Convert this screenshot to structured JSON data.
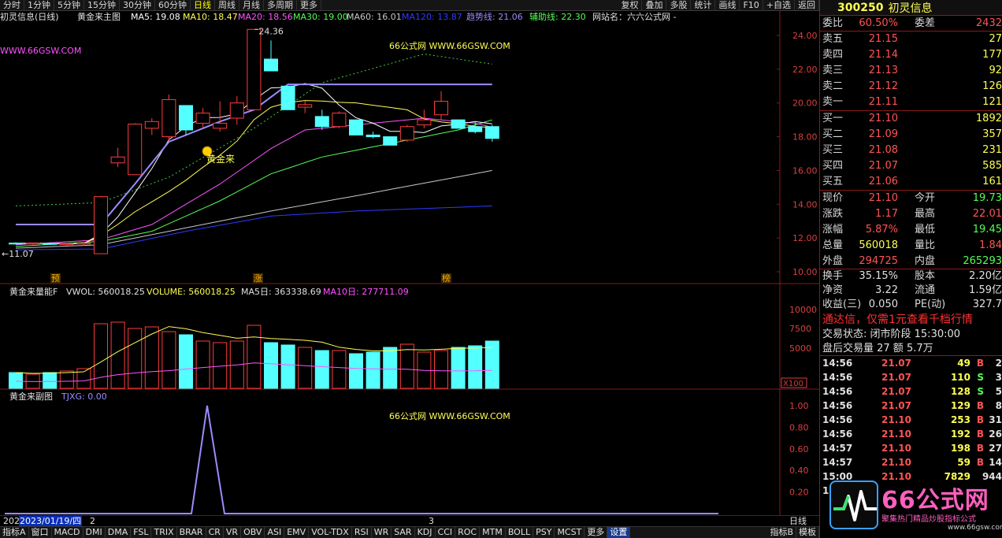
{
  "toolbar": {
    "left_tabs": [
      "分时",
      "1分钟",
      "5分钟",
      "15分钟",
      "30分钟",
      "60分钟",
      "日线",
      "周线",
      "月线",
      "多周期",
      "更多"
    ],
    "active_tab": "日线",
    "right_tabs": [
      "复权",
      "叠加",
      "多股",
      "统计",
      "画线",
      "F10",
      "+自选",
      "返回"
    ]
  },
  "main_pane": {
    "title": "初灵信息(日线)",
    "indicator": "黄金来主图",
    "readouts": [
      {
        "label": "MA5: 19.08",
        "color": "#ffffff"
      },
      {
        "label": "MA10: 18.47",
        "color": "#ffff54"
      },
      {
        "label": "MA20: 18.56",
        "color": "#ff54ff"
      },
      {
        "label": "MA30: 19.00",
        "color": "#54ff54"
      },
      {
        "label": "MA60: 16.01",
        "color": "#c8c8c8"
      },
      {
        "label": "MA120: 13.87",
        "color": "#2f3bff"
      },
      {
        "label": "趋势线: 21.06",
        "color": "#9a8cff"
      },
      {
        "label": "辅助线: 22.30",
        "color": "#54ff54"
      },
      {
        "label": "网站名：六六公式网 -",
        "color": "#e0e0e0"
      }
    ],
    "url_label": "WWW.66GSW.COM",
    "watermark": "66公式网 WWW.66GSW.COM",
    "y_ticks": [
      "24.00",
      "22.00",
      "20.00",
      "18.00",
      "16.00",
      "14.00",
      "12.00",
      "10.00"
    ],
    "high_label": "24.36",
    "low_label": "←11.07",
    "signal_label": "黄金来",
    "bottom_tags": [
      "预",
      "涨",
      "榜"
    ]
  },
  "volume_pane": {
    "indicator": "黄金来量能F",
    "readouts": [
      {
        "label": "VWOL: 560018.25",
        "color": "#e0e0e0"
      },
      {
        "label": "VOLUME: 560018.25",
        "color": "#ffff54"
      },
      {
        "label": "MA5日: 363338.69",
        "color": "#e0e0e0"
      },
      {
        "label": "MA10日: 277711.09",
        "color": "#ff54ff"
      }
    ],
    "y_ticks": [
      "10000",
      "7500",
      "5000"
    ],
    "unit": "X100"
  },
  "sub_pane": {
    "indicator": "黄金来副图",
    "readout": "TJXG: 0.00",
    "watermark": "66公式网 WWW.66GSW.COM",
    "y_ticks": [
      "1.00",
      "0.80",
      "0.60",
      "0.40",
      "0.20"
    ]
  },
  "date_strip": {
    "left": "202",
    "cursor_date": "2023/01/19/四",
    "mark_a": "2",
    "mark_b": "3",
    "period": "日线"
  },
  "bottom_tabs": [
    "指标A",
    "窗口",
    "MACD",
    "DMI",
    "DMA",
    "FSL",
    "TRIX",
    "BRAR",
    "CR",
    "VR",
    "OBV",
    "ASI",
    "EMV",
    "VOL-TDX",
    "RSI",
    "WR",
    "SAR",
    "KDJ",
    "CCI",
    "ROC",
    "MTM",
    "BOLL",
    "PSY",
    "MCST",
    "更多",
    "设置"
  ],
  "bottom_tabs_active": "设置",
  "bottom_tabs_right": [
    "指标B",
    "模板"
  ],
  "quote": {
    "code": "300250",
    "name": "初灵信息",
    "weibi_label": "委比",
    "weibi": "60.50%",
    "weicha_label": "委差",
    "weicha": "2432",
    "asks": [
      {
        "label": "卖五",
        "price": "21.15",
        "vol": "27"
      },
      {
        "label": "卖四",
        "price": "21.14",
        "vol": "177"
      },
      {
        "label": "卖三",
        "price": "21.13",
        "vol": "92"
      },
      {
        "label": "卖二",
        "price": "21.12",
        "vol": "126"
      },
      {
        "label": "卖一",
        "price": "21.11",
        "vol": "121"
      }
    ],
    "bids": [
      {
        "label": "买一",
        "price": "21.10",
        "vol": "1892"
      },
      {
        "label": "买二",
        "price": "21.09",
        "vol": "357"
      },
      {
        "label": "买三",
        "price": "21.08",
        "vol": "231"
      },
      {
        "label": "买四",
        "price": "21.07",
        "vol": "585"
      },
      {
        "label": "买五",
        "price": "21.06",
        "vol": "161"
      }
    ],
    "stats": [
      {
        "l1": "现价",
        "v1": "21.10",
        "c1": "red",
        "l2": "今开",
        "v2": "19.73",
        "c2": "green"
      },
      {
        "l1": "涨跌",
        "v1": "1.17",
        "c1": "red",
        "l2": "最高",
        "v2": "22.01",
        "c2": "red"
      },
      {
        "l1": "涨幅",
        "v1": "5.87%",
        "c1": "red",
        "l2": "最低",
        "v2": "19.45",
        "c2": "green"
      },
      {
        "l1": "总量",
        "v1": "560018",
        "c1": "yellow",
        "l2": "量比",
        "v2": "1.84",
        "c2": "red"
      },
      {
        "l1": "外盘",
        "v1": "294725",
        "c1": "red",
        "l2": "内盘",
        "v2": "265293",
        "c2": "green"
      },
      {
        "l1": "换手",
        "v1": "35.15%",
        "c1": "white",
        "l2": "股本",
        "v2": "2.20亿",
        "c2": "white"
      },
      {
        "l1": "净资",
        "v1": "3.22",
        "c1": "white",
        "l2": "流通",
        "v2": "1.59亿",
        "c2": "white"
      },
      {
        "l1": "收益(三)",
        "v1": "0.050",
        "c1": "white",
        "l2": "PE(动)",
        "v2": "327.7",
        "c2": "white"
      }
    ],
    "ad": "通达信，仅需1元查看千档行情",
    "trade_status": "交易状态: 闭市阶段 15:30:00",
    "after_hours": "盘后交易量 27 额 5.7万",
    "ticks": [
      {
        "time": "14:56",
        "price": "21.07",
        "vol": "49",
        "side": "B",
        "n": "2"
      },
      {
        "time": "14:56",
        "price": "21.07",
        "vol": "110",
        "side": "S",
        "n": "3"
      },
      {
        "time": "14:56",
        "price": "21.07",
        "vol": "128",
        "side": "S",
        "n": "5"
      },
      {
        "time": "14:56",
        "price": "21.07",
        "vol": "129",
        "side": "B",
        "n": "8"
      },
      {
        "time": "14:56",
        "price": "21.10",
        "vol": "253",
        "side": "B",
        "n": "31"
      },
      {
        "time": "14:56",
        "price": "21.10",
        "vol": "192",
        "side": "B",
        "n": "26"
      },
      {
        "time": "14:57",
        "price": "21.10",
        "vol": "198",
        "side": "B",
        "n": "27"
      },
      {
        "time": "14:57",
        "price": "21.10",
        "vol": "59",
        "side": "B",
        "n": "14"
      },
      {
        "time": "15:00",
        "price": "21.10",
        "vol": "7829",
        "side": "",
        "n": "944"
      }
    ],
    "last_time": "15"
  },
  "logo": {
    "text": "66公式网",
    "tagline": "聚集热门精品炒股指标公式",
    "url": "www.66gsw.com"
  },
  "colors": {
    "up": "#ff3c3c",
    "down": "#54ffff",
    "ma5": "#ffffff",
    "ma10": "#ffff54",
    "ma20": "#ff54ff",
    "ma30": "#54ff54",
    "ma60": "#c8c8c8",
    "ma120": "#2f3bff",
    "trend": "#9a8cff",
    "aux": "#3fcf3f",
    "axis": "#8a1a1a"
  },
  "chart_data": [
    {
      "type": "candlestick",
      "title": "初灵信息(日线)",
      "ylim": [
        10,
        24.4
      ],
      "ohlc": [
        [
          11.7,
          11.75,
          11.62,
          11.68
        ],
        [
          11.66,
          11.72,
          11.6,
          11.7
        ],
        [
          11.68,
          11.75,
          11.6,
          11.65
        ],
        [
          11.62,
          11.7,
          11.55,
          11.66
        ],
        [
          11.64,
          11.75,
          11.55,
          11.7
        ],
        [
          11.07,
          14.5,
          11.07,
          14.45
        ],
        [
          16.45,
          17.35,
          16.2,
          16.8
        ],
        [
          15.75,
          18.8,
          15.75,
          18.75
        ],
        [
          18.5,
          19.1,
          18.1,
          18.9
        ],
        [
          18.0,
          20.5,
          17.7,
          20.2
        ],
        [
          19.85,
          19.85,
          18.1,
          18.4
        ],
        [
          18.8,
          19.7,
          18.5,
          19.4
        ],
        [
          18.5,
          20.1,
          18.3,
          18.8
        ],
        [
          19.1,
          20.4,
          18.7,
          20.0
        ],
        [
          19.6,
          24.36,
          19.6,
          24.36
        ],
        [
          22.6,
          23.7,
          22.2,
          21.9
        ],
        [
          21.0,
          21.0,
          19.6,
          19.6
        ],
        [
          19.75,
          20.1,
          19.4,
          19.9
        ],
        [
          19.2,
          19.6,
          18.4,
          18.6
        ],
        [
          18.6,
          19.5,
          18.5,
          19.4
        ],
        [
          19.0,
          19.0,
          18.1,
          18.1
        ],
        [
          18.1,
          18.3,
          17.9,
          18.0
        ],
        [
          18.0,
          18.0,
          17.5,
          17.5
        ],
        [
          17.8,
          18.7,
          17.7,
          18.6
        ],
        [
          18.7,
          19.6,
          18.5,
          19.0
        ],
        [
          19.3,
          20.7,
          19.0,
          20.1
        ],
        [
          19.0,
          19.0,
          18.6,
          18.5
        ],
        [
          18.6,
          18.9,
          18.2,
          18.3
        ],
        [
          18.6,
          18.7,
          17.7,
          17.9
        ]
      ],
      "closing_note": "illustrative estimated from axis"
    }
  ]
}
